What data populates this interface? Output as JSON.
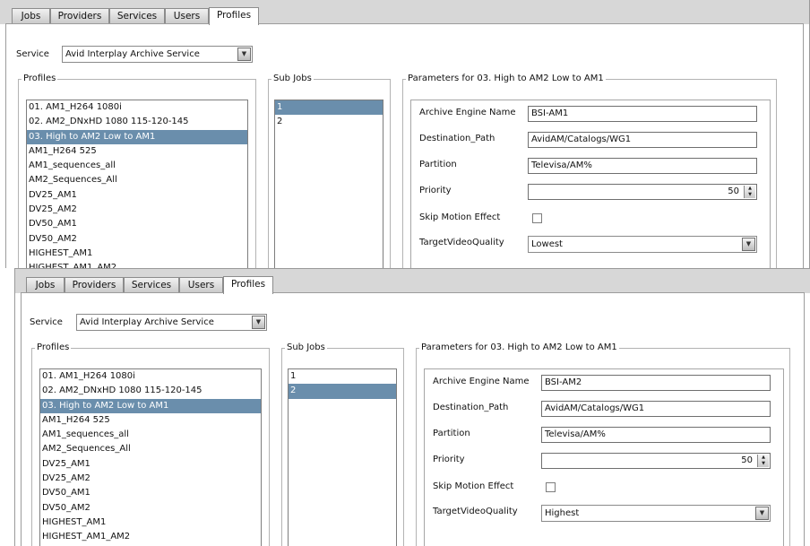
{
  "tabs": [
    "Jobs",
    "Providers",
    "Services",
    "Users",
    "Profiles"
  ],
  "service": {
    "label": "Service",
    "value": "Avid Interplay Archive Service"
  },
  "profiles": {
    "legend": "Profiles",
    "items": [
      "01. AM1_H264 1080i",
      "02. AM2_DNxHD 1080 115-120-145",
      "03. High to AM2 Low to AM1",
      "AM1_H264 525",
      "AM1_sequences_all",
      "AM2_Sequences_All",
      "DV25_AM1",
      "DV25_AM2",
      "DV50_AM1",
      "DV50_AM2",
      "HIGHEST_AM1",
      "HIGHEST_AM1_AM2"
    ]
  },
  "subjobs": {
    "legend": "Sub Jobs",
    "items": [
      "1",
      "2"
    ]
  },
  "params": {
    "legend": "Parameters for 03. High to AM2 Low to AM1",
    "labels": {
      "archive_engine": "Archive Engine Name",
      "destination": "Destination_Path",
      "partition": "Partition",
      "priority": "Priority",
      "skip_motion": "Skip Motion Effect",
      "target_quality": "TargetVideoQuality"
    }
  },
  "screens": [
    {
      "selected_subjob": "1",
      "archive_engine": "BSI-AM1",
      "destination": "AvidAM/Catalogs/WG1",
      "partition": "Televisa/AM%",
      "priority": "50",
      "skip_motion": false,
      "target_quality": "Lowest"
    },
    {
      "selected_subjob": "2",
      "archive_engine": "BSI-AM2",
      "destination": "AvidAM/Catalogs/WG1",
      "partition": "Televisa/AM%",
      "priority": "50",
      "skip_motion": false,
      "target_quality": "Highest"
    }
  ],
  "ui": {
    "selected_profile": "03. High to AM2 Low to AM1",
    "active_tab": "Profiles",
    "colors": {
      "selection": "#6a8eac",
      "tab_bar": "#d7d7d7"
    },
    "icons": {
      "dropdown": "chevron-down-icon",
      "spinner": "spinner-arrows-icon"
    }
  }
}
